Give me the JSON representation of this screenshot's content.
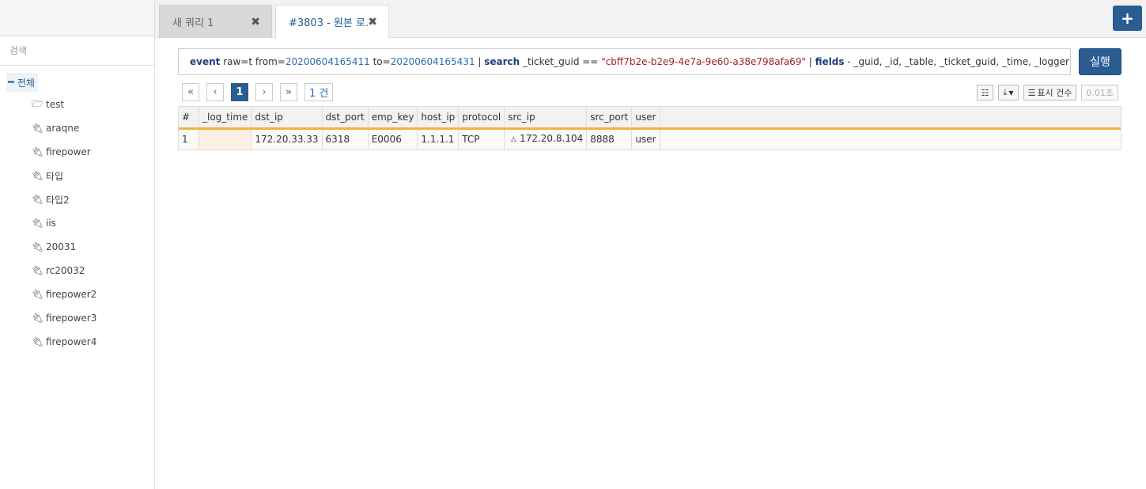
{
  "sidebar": {
    "search_placeholder": "검색",
    "root": {
      "label": "전체",
      "icon": "minus-icon"
    },
    "items": [
      {
        "label": "test",
        "icon": "folder-open-icon"
      },
      {
        "label": "araqne",
        "icon": "plug-icon"
      },
      {
        "label": "firepower",
        "icon": "plug-icon"
      },
      {
        "label": "타입",
        "icon": "plug-icon"
      },
      {
        "label": "타입2",
        "icon": "plug-icon"
      },
      {
        "label": "iis",
        "icon": "plug-icon"
      },
      {
        "label": "20031",
        "icon": "plug-icon"
      },
      {
        "label": "rc20032",
        "icon": "plug-icon"
      },
      {
        "label": "firepower2",
        "icon": "plug-icon"
      },
      {
        "label": "firepower3",
        "icon": "plug-icon"
      },
      {
        "label": "firepower4",
        "icon": "plug-icon"
      }
    ]
  },
  "tabs": [
    {
      "label": "새 쿼리 1",
      "active": false
    },
    {
      "label": "#3803 - 원본 로...",
      "active": true
    }
  ],
  "query": {
    "event_kw": "event",
    "raw_part": " raw=t from=",
    "from_val": "20200604165411",
    "to_part": " to=",
    "to_val": "20200604165431",
    "pipe1": " | ",
    "search_kw": "search",
    "search_field": " _ticket_guid == ",
    "search_val": "\"cbff7b2e-b2e9-4e7a-9e60-a38e798afa69\"",
    "pipe2": " | ",
    "fields_kw": "fields",
    "fields_list": " - _guid, _id, _table, _ticket_guid, _time, _logger, _rule, _rule_type"
  },
  "run_label": "실행",
  "pager": {
    "first": "«",
    "prev": "‹",
    "current": "1",
    "next": "›",
    "last": "»",
    "count": "1 건"
  },
  "tools": {
    "display_count_label": "표시 건수",
    "elapsed": "0.01초"
  },
  "table": {
    "columns": [
      "#",
      "_log_time",
      "dst_ip",
      "dst_port",
      "emp_key",
      "host_ip",
      "protocol",
      "src_ip",
      "src_port",
      "user"
    ],
    "rows": [
      [
        "1",
        "",
        "172.20.33.33",
        "6318",
        "E0006",
        "1.1.1.1",
        "TCP",
        "172.20.8.104",
        "8888",
        "user"
      ]
    ]
  },
  "colors": {
    "accent": "#2a5d92",
    "header_underline": "#f0b43c"
  }
}
